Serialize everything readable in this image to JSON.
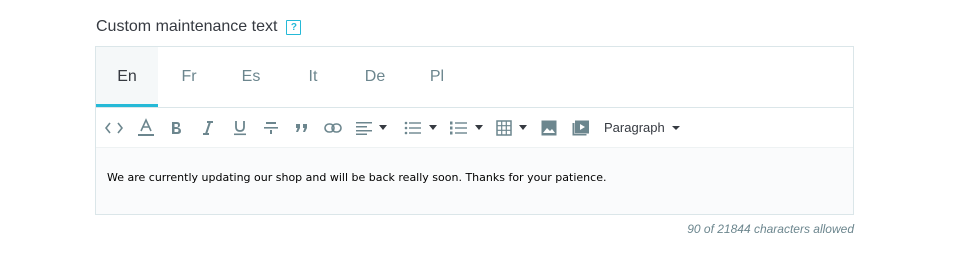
{
  "field": {
    "label": "Custom maintenance text",
    "help_badge": "?"
  },
  "tabs": [
    {
      "label": "En",
      "active": true
    },
    {
      "label": "Fr",
      "active": false
    },
    {
      "label": "Es",
      "active": false
    },
    {
      "label": "It",
      "active": false
    },
    {
      "label": "De",
      "active": false
    },
    {
      "label": "Pl",
      "active": false
    }
  ],
  "toolbar": {
    "icons": [
      "code-icon",
      "font-color-icon",
      "bold-icon",
      "italic-icon",
      "underline-icon",
      "strikethrough-icon",
      "blockquote-icon",
      "link-icon",
      "align-left-icon",
      "bullet-list-icon",
      "numbered-list-icon",
      "table-icon",
      "image-icon",
      "media-icon"
    ],
    "block_format": "Paragraph"
  },
  "editor": {
    "content": "We are currently updating our shop and will be back really soon. Thanks for your patience."
  },
  "counter": {
    "text": "90 of 21844 characters allowed"
  },
  "colors": {
    "accent": "#25b9d7",
    "muted": "#6c868e",
    "border": "#dbe6e9"
  }
}
